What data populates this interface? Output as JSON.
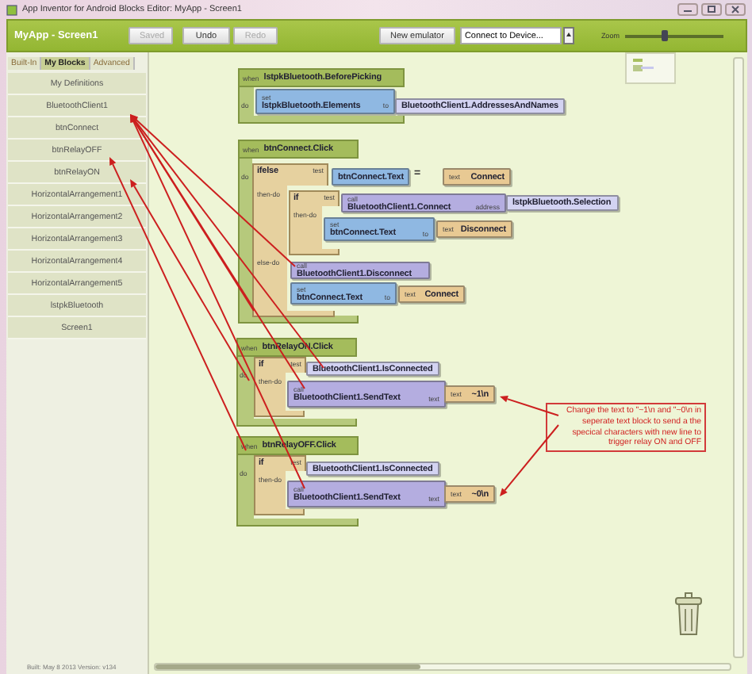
{
  "window": {
    "title": "App Inventor for Android Blocks Editor: MyApp - Screen1"
  },
  "toolbar": {
    "project_title": "MyApp - Screen1",
    "buttons": [
      {
        "label": "Saved",
        "disabled": true
      },
      {
        "label": "Undo",
        "disabled": false
      },
      {
        "label": "Redo",
        "disabled": true
      }
    ],
    "emulator_button": "New emulator",
    "device_select": {
      "value": "Connect to Device..."
    },
    "zoom": {
      "label": "Zoom",
      "level": 0.4
    }
  },
  "palette": {
    "tabs": [
      {
        "label": "Built-In",
        "selected": false
      },
      {
        "label": "My Blocks",
        "selected": true
      },
      {
        "label": "Advanced",
        "selected": false
      }
    ],
    "items": [
      "My Definitions",
      "BluetoothClient1",
      "btnConnect",
      "btnRelayOFF",
      "btnRelayON",
      "HorizontalArrangement1",
      "HorizontalArrangement2",
      "HorizontalArrangement3",
      "HorizontalArrangement4",
      "HorizontalArrangement5",
      "lstpkBluetooth",
      "Screen1"
    ],
    "build_info": "Built: May 8 2013 Version: v134"
  },
  "canvas": {
    "blocks": [
      {
        "kind": "event",
        "when": "when",
        "name": "lstpkBluetooth.BeforePicking",
        "do": "do"
      },
      {
        "kind": "setter",
        "set": "set",
        "name": "lstpkBluetooth.Elements",
        "to": "to"
      },
      {
        "kind": "getter",
        "name": "BluetoothClient1.AddressesAndNames"
      },
      {
        "kind": "event",
        "when": "when",
        "name": "btnConnect.Click",
        "do": "do"
      },
      {
        "kind": "control",
        "name": "ifelse",
        "test": "test",
        "then_do": "then-do",
        "else_do": "else-do"
      },
      {
        "kind": "property",
        "name": "btnConnect.Text"
      },
      {
        "kind": "operator",
        "symbol": "="
      },
      {
        "kind": "text",
        "tag": "text",
        "value": "Connect"
      },
      {
        "kind": "control",
        "name": "if",
        "test": "test",
        "then_do": "then-do"
      },
      {
        "kind": "call",
        "call": "call",
        "name": "BluetoothClient1.Connect",
        "arg": "address"
      },
      {
        "kind": "getter",
        "name": "lstpkBluetooth.Selection"
      },
      {
        "kind": "setter",
        "set": "set",
        "name": "btnConnect.Text",
        "to": "to"
      },
      {
        "kind": "text",
        "tag": "text",
        "value": "Disconnect"
      },
      {
        "kind": "call",
        "call": "call",
        "name": "BluetoothClient1.Disconnect"
      },
      {
        "kind": "setter",
        "set": "set",
        "name": "btnConnect.Text",
        "to": "to"
      },
      {
        "kind": "text",
        "tag": "text",
        "value": "Connect"
      },
      {
        "kind": "event",
        "when": "when",
        "name": "btnRelayON.Click",
        "do": "do"
      },
      {
        "kind": "control",
        "name": "if",
        "test": "test",
        "then_do": "then-do"
      },
      {
        "kind": "getter",
        "name": "BluetoothClient1.IsConnected"
      },
      {
        "kind": "call",
        "call": "call",
        "name": "BluetoothClient1.SendText",
        "arg": "text"
      },
      {
        "kind": "text",
        "tag": "text",
        "value": "~1\\n"
      },
      {
        "kind": "event",
        "when": "when",
        "name": "btnRelayOFF.Click",
        "do": "do"
      },
      {
        "kind": "control",
        "name": "if",
        "test": "test",
        "then_do": "then-do"
      },
      {
        "kind": "getter",
        "name": "BluetoothClient1.IsConnected"
      },
      {
        "kind": "call",
        "call": "call",
        "name": "BluetoothClient1.SendText",
        "arg": "text"
      },
      {
        "kind": "text",
        "tag": "text",
        "value": "~0\\n"
      }
    ],
    "note": "Change the text to  \"~1\\n and \"~0\\n in seperate text block to send a the specical characters with new line  to trigger relay ON and OFF"
  }
}
